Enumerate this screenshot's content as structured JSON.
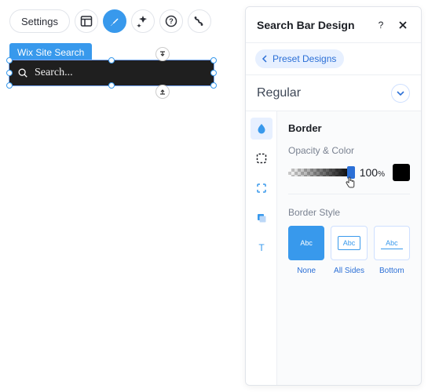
{
  "toolbar": {
    "settings_label": "Settings"
  },
  "canvas": {
    "element_tag": "Wix Site Search",
    "search_placeholder": "Search..."
  },
  "panel": {
    "title": "Search Bar Design",
    "back_label": "Preset Designs",
    "state_label": "Regular",
    "section_title": "Border",
    "opacity_label": "Opacity & Color",
    "opacity_value": "100",
    "opacity_unit": "%",
    "border_style_label": "Border Style",
    "styles": {
      "none": "None",
      "all": "All Sides",
      "bottom": "Bottom",
      "sample": "Abc"
    },
    "swatch_color": "#000000"
  }
}
